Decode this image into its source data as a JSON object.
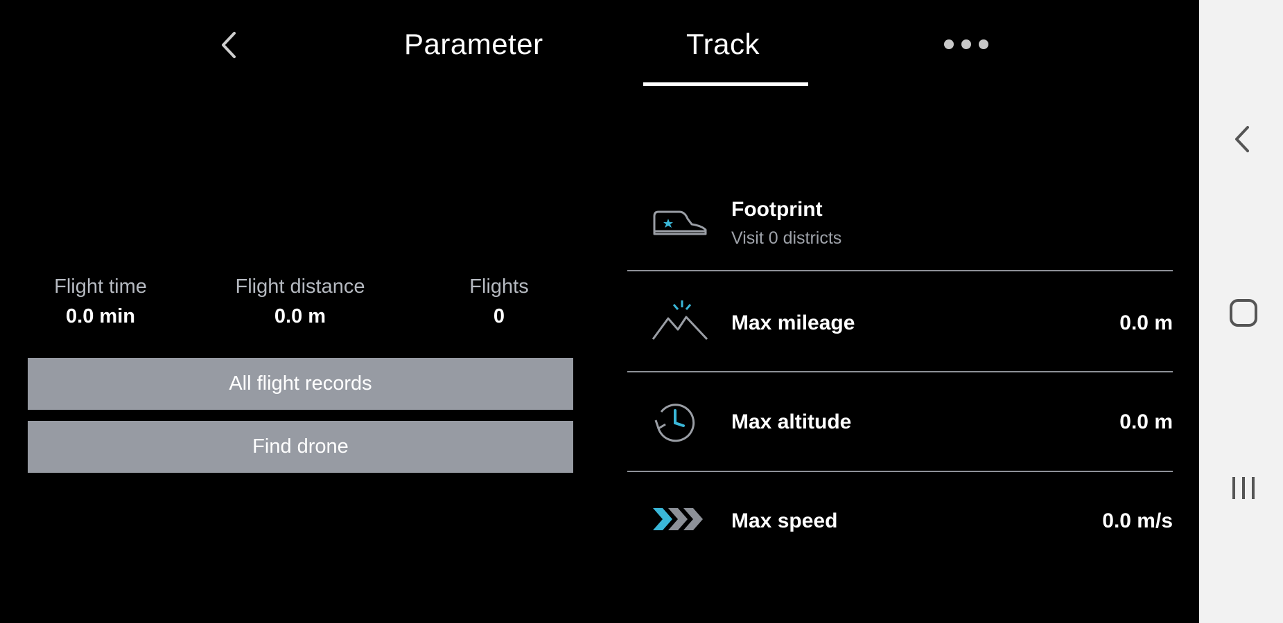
{
  "header": {
    "tabs": [
      {
        "label": "Parameter",
        "active": false
      },
      {
        "label": "Track",
        "active": true
      }
    ],
    "back_icon": "chevron-left-icon",
    "more_icon": "more-horizontal-icon"
  },
  "stats": [
    {
      "label": "Flight time",
      "value": "0.0 min"
    },
    {
      "label": "Flight distance",
      "value": "0.0 m"
    },
    {
      "label": "Flights",
      "value": "0"
    }
  ],
  "buttons": {
    "all_records": "All flight records",
    "find_drone": "Find drone"
  },
  "track": {
    "footprint": {
      "title": "Footprint",
      "subtitle": "Visit 0 districts",
      "icon": "sneaker-icon"
    },
    "items": [
      {
        "label": "Max mileage",
        "value": "0.0 m",
        "icon": "mountain-icon"
      },
      {
        "label": "Max altitude",
        "value": "0.0 m",
        "icon": "clock-history-icon"
      },
      {
        "label": "Max speed",
        "value": "0.0 m/s",
        "icon": "speed-arrows-icon"
      }
    ]
  },
  "colors": {
    "background": "#000000",
    "button": "#979ba3",
    "accent": "#3ab7d8",
    "divider": "#8e9198"
  }
}
